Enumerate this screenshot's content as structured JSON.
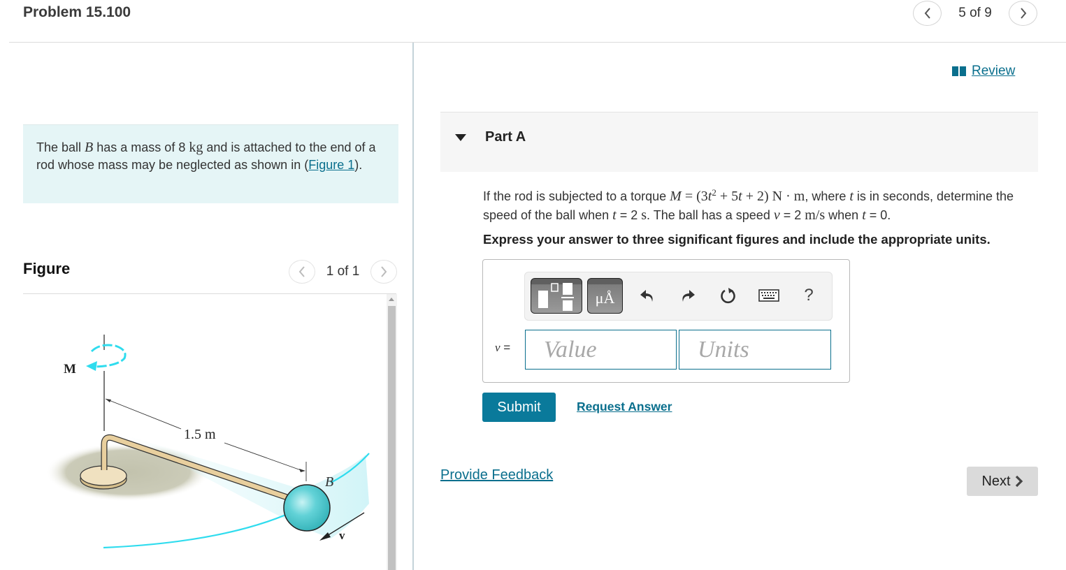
{
  "header": {
    "problem_title": "Problem 15.100",
    "pagination": {
      "current": 5,
      "total": 9,
      "label": "5 of 9"
    },
    "prev_icon": "chevron-left-icon",
    "next_icon": "chevron-right-icon"
  },
  "intro": {
    "text_1": "The ball ",
    "var_ball": "B",
    "text_2": " has a mass of 8 ",
    "unit_mass": "kg",
    "text_3": " and is attached to the end of a rod whose mass may be neglected as shown in ",
    "paren_open": "(",
    "figure_link": "Figure 1",
    "paren_close": ")."
  },
  "figure_panel": {
    "title": "Figure",
    "pagination_label": "1 of 1",
    "labels": {
      "moment": "M",
      "length": "1.5 m",
      "ball": "B",
      "velocity": "v"
    },
    "colors": {
      "rod": "#e8cf9e",
      "ball": "#5ccfd4",
      "trajectory": "#2fdcee",
      "ground_shadow": "#c8c8b6"
    }
  },
  "review": {
    "label": "Review",
    "icon": "book-icon"
  },
  "part_a": {
    "title": "Part A",
    "question": {
      "t1": "If the rod is subjected to a torque ",
      "m_var": "M",
      "m_eq": " = (3",
      "m_t1": "t",
      "m_exp": "2",
      "m_mid": " + 5",
      "m_t2": "t",
      "m_end": " + 2) N · m",
      "t2": ", where ",
      "t_var": "t",
      "t3": " is in seconds, determine the speed of the ball when ",
      "t_var2": "t",
      "t4": " = 2 ",
      "unit_s": "s",
      "t5": ". The ball has a speed ",
      "v_var": "v",
      "t6": " = 2 ",
      "unit_ms": "m/s",
      "t7": " when ",
      "t_var3": "t",
      "t8": " = 0."
    },
    "instruction": "Express your answer to three significant figures and include the appropriate units.",
    "toolbar": {
      "template_button": "templates-icon",
      "units_button_label": "μÅ",
      "undo": "undo-icon",
      "redo": "redo-icon",
      "reset": "reset-icon",
      "keyboard": "keyboard-icon",
      "help_label": "?"
    },
    "answer": {
      "variable_label": "v =",
      "value_placeholder": "Value",
      "value": "",
      "units_placeholder": "Units",
      "units": ""
    },
    "submit_label": "Submit",
    "request_answer_label": "Request Answer"
  },
  "footer": {
    "feedback_label": "Provide Feedback",
    "next_label": "Next"
  },
  "colors": {
    "accent": "#0a7a9b",
    "link": "#0a6f8d",
    "intro_bg": "#e5f5f6",
    "next_bg": "#dadada"
  }
}
